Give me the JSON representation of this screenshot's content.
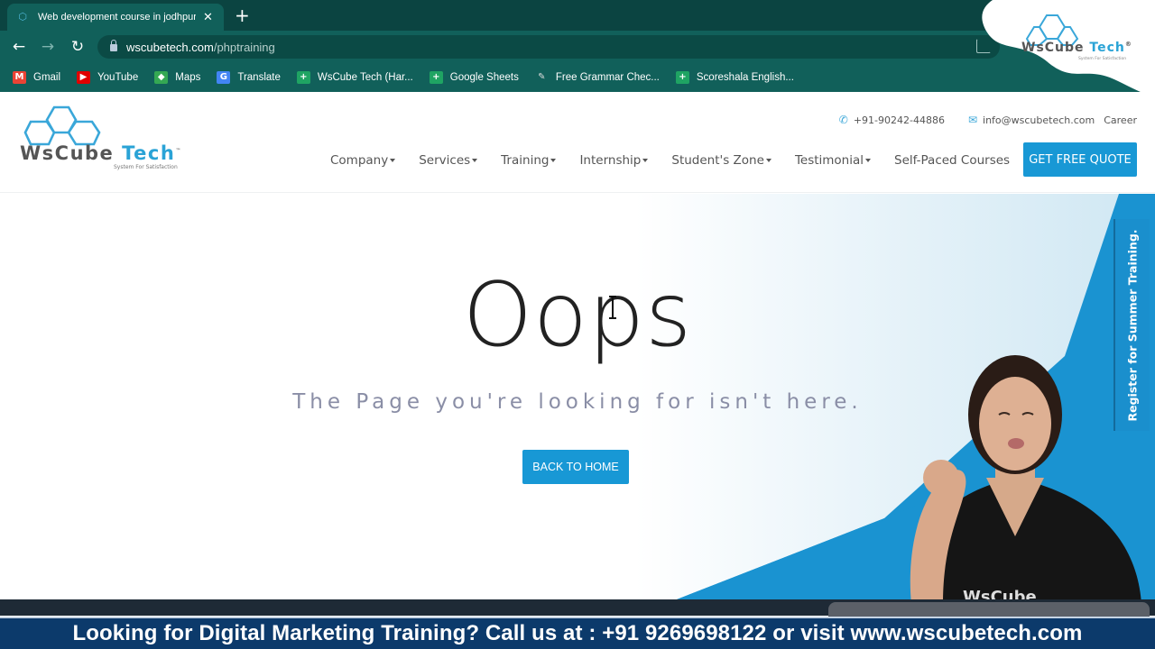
{
  "browser": {
    "tab": {
      "title": "Web development course in jodhpur",
      "favicon": "wscube-favicon-icon"
    },
    "new_tab_label": "+",
    "url": {
      "host": "wscubetech.com",
      "path": "/phptraining"
    },
    "bookmarks": [
      {
        "label": "Gmail",
        "icon": "gmail-icon",
        "color": "#ea4335",
        "glyph": "M"
      },
      {
        "label": "YouTube",
        "icon": "youtube-icon",
        "color": "#e00000",
        "glyph": "▶"
      },
      {
        "label": "Maps",
        "icon": "maps-icon",
        "color": "#34a853",
        "glyph": "◆"
      },
      {
        "label": "Translate",
        "icon": "translate-icon",
        "color": "#4285f4",
        "glyph": "G"
      },
      {
        "label": "WsCube Tech (Har...",
        "icon": "sheets-icon",
        "color": "#1fa463",
        "glyph": "+"
      },
      {
        "label": "Google Sheets",
        "icon": "sheets-icon",
        "color": "#1fa463",
        "glyph": "+"
      },
      {
        "label": "Free Grammar Chec...",
        "icon": "quill-icon",
        "color": "#11605a",
        "glyph": "✎"
      },
      {
        "label": "Scoreshala English...",
        "icon": "sheets-icon",
        "color": "#1fa463",
        "glyph": "+"
      }
    ]
  },
  "watermark": {
    "brand": "WsCube",
    "brand_accent": "Tech",
    "mark": "®",
    "tagline": "System For Satisfaction"
  },
  "site": {
    "logo": {
      "brand": "WsCube ",
      "brand_accent": "Tech",
      "tm": "™",
      "tagline": "System For Satisfaction"
    },
    "contact": {
      "phone": "+91-90242-44886",
      "email": "info@wscubetech.com",
      "career": "Career"
    },
    "nav": [
      {
        "label": "Company",
        "dropdown": true
      },
      {
        "label": "Services",
        "dropdown": true
      },
      {
        "label": "Training",
        "dropdown": true
      },
      {
        "label": "Internship",
        "dropdown": true
      },
      {
        "label": "Student's Zone",
        "dropdown": true
      },
      {
        "label": "Testimonial",
        "dropdown": true
      },
      {
        "label": "Self-Paced Courses",
        "dropdown": false
      }
    ],
    "cta": "GET FREE QUOTE",
    "colors": {
      "accent": "#1898d5",
      "text": "#555555",
      "accent_dark": "#136b9c"
    }
  },
  "error_page": {
    "heading": "Oops",
    "message": "The Page you're looking for isn't here.",
    "button": "BACK TO HOME"
  },
  "side_tab": {
    "label": "Register for Summer Training."
  },
  "presenter": {
    "shirt_text": "WsCube"
  },
  "ticker": {
    "text": "Looking for Digital Marketing Training? Call us at : +91 9269698122 or visit www.wscubetech.com",
    "background": "#0c3a6b"
  }
}
